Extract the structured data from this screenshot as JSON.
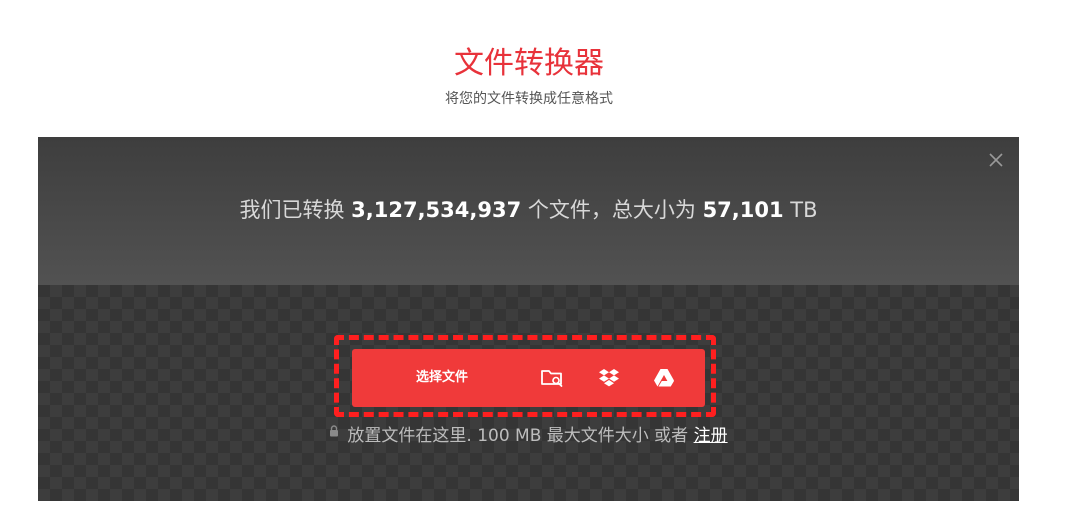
{
  "header": {
    "title": "文件转换器",
    "subtitle": "将您的文件转换成任意格式"
  },
  "stats": {
    "prefix": "我们已转换 ",
    "files_count": "3,127,534,937",
    "middle": " 个文件，总大小为 ",
    "total_size": "57,101",
    "unit": " TB"
  },
  "upload": {
    "choose_label": "选择文件",
    "sources": [
      "folder-search-icon",
      "dropbox-icon",
      "google-drive-icon"
    ]
  },
  "drop_hint": {
    "text": "放置文件在这里. 100 MB 最大文件大小 或者 ",
    "signup_label": "注册"
  },
  "colors": {
    "accent": "#e8323a",
    "button": "#f03a3a",
    "highlight": "#ff1f1f",
    "panel": "#3b3b3b"
  }
}
